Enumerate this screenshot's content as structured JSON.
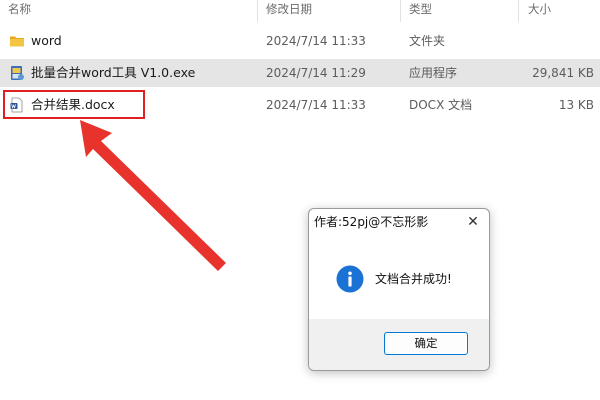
{
  "columns": {
    "name": "名称",
    "date": "修改日期",
    "type": "类型",
    "size": "大小"
  },
  "files": [
    {
      "name": "word",
      "date": "2024/7/14 11:33",
      "type": "文件夹",
      "size": "",
      "icon": "folder-icon",
      "selected": false
    },
    {
      "name": "批量合并word工具 V1.0.exe",
      "date": "2024/7/14 11:29",
      "type": "应用程序",
      "size": "29,841 KB",
      "icon": "exe-installer-icon",
      "selected": true
    },
    {
      "name": "合并结果.docx",
      "date": "2024/7/14 11:33",
      "type": "DOCX 文档",
      "size": "13 KB",
      "icon": "word-document-icon",
      "selected": false
    }
  ],
  "dialog": {
    "title": "作者:52pj@不忘形影",
    "close_symbol": "✕",
    "message": "文档合并成功!",
    "ok_label": "确定",
    "icon": "info-icon"
  },
  "colors": {
    "accent": "#0078d4",
    "highlight": "#e02020",
    "selected_row": "#e5e5e5",
    "folder": "#f4c542"
  }
}
